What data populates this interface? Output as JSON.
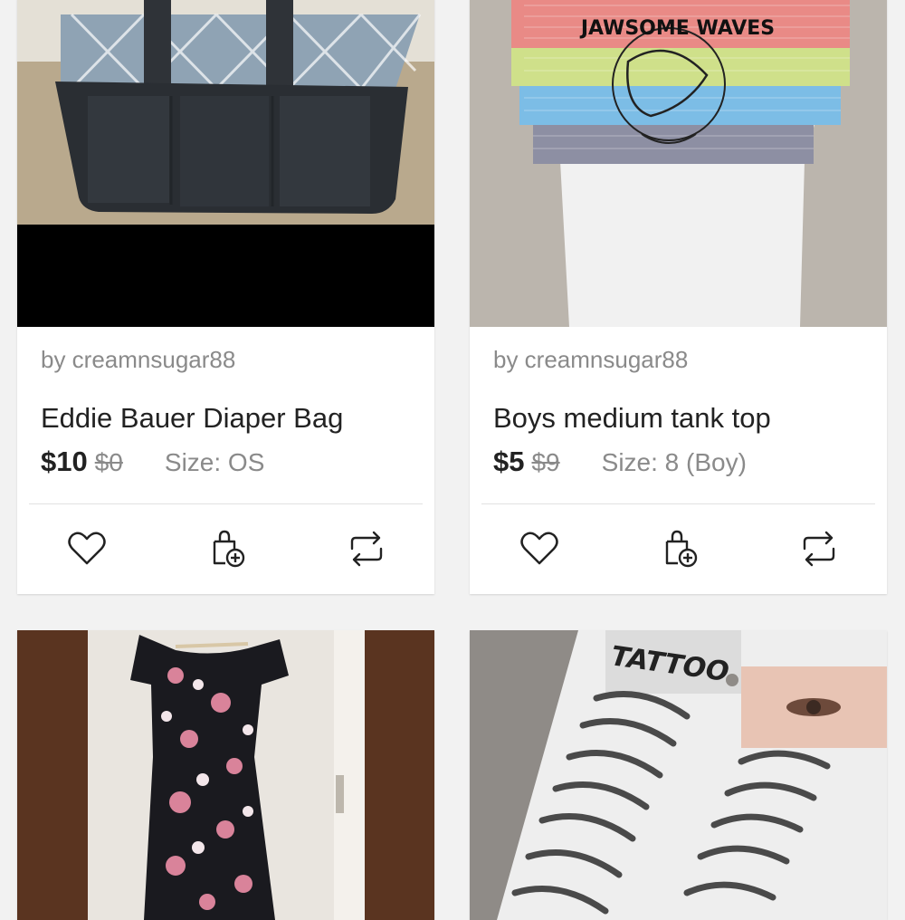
{
  "listings": [
    {
      "seller": "by creamnsugar88",
      "title": "Eddie Bauer Diaper Bag",
      "price": "$10",
      "original_price": "$0",
      "size": "Size: OS",
      "actions": [
        "heart-icon",
        "bundle-icon",
        "share-icon"
      ]
    },
    {
      "seller": "by creamnsugar88",
      "title": "Boys medium tank top",
      "price": "$5",
      "original_price": "$9",
      "size": "Size: 8 (Boy)",
      "actions": [
        "heart-icon",
        "bundle-icon",
        "share-icon"
      ],
      "image_text": "JAWSOME WAVES"
    },
    {
      "seller": "",
      "title": "",
      "price": "",
      "original_price": "",
      "size": ""
    },
    {
      "seller": "",
      "title": "",
      "price": "",
      "original_price": "",
      "size": "",
      "image_text": "TATTOO"
    }
  ]
}
